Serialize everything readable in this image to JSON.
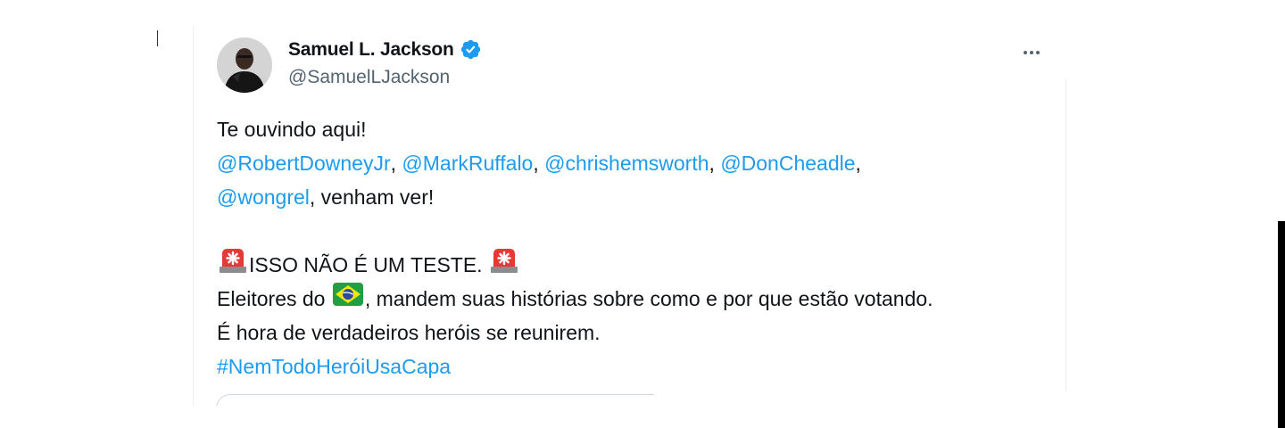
{
  "author": {
    "name": "Samuel L. Jackson",
    "handle": "@SamuelLJackson",
    "verified": true
  },
  "more_menu": {
    "icon": "more-horizontal-icon"
  },
  "tweet": {
    "line1": "Te ouvindo aqui!",
    "mention_robert": "@RobertDowneyJr",
    "mention_mark": "@MarkRuffalo",
    "mention_chris": "@chrishemsworth",
    "mention_don": "@DonCheadle",
    "mention_wong": "@wongrel",
    "sep": ", ",
    "trailing_comma": ",",
    "line3_rest": ", venham ver!",
    "alert_text": "ISSO NÃO É UM TESTE. ",
    "line5_start": "Eleitores do ",
    "line5_end": ", mandem suas histórias sobre como e por que estão votando.",
    "line6": "É hora de verdadeiros heróis se reunirem.",
    "hashtag": "#NemTodoHeróiUsaCapa"
  },
  "colors": {
    "link": "#1d9bf0",
    "text": "#0f1419",
    "secondary": "#536471",
    "verified": "#1d9bf0"
  },
  "icons": [
    "verified-badge-icon",
    "more-horizontal-icon",
    "siren-emoji-icon",
    "brazil-flag-emoji-icon"
  ]
}
